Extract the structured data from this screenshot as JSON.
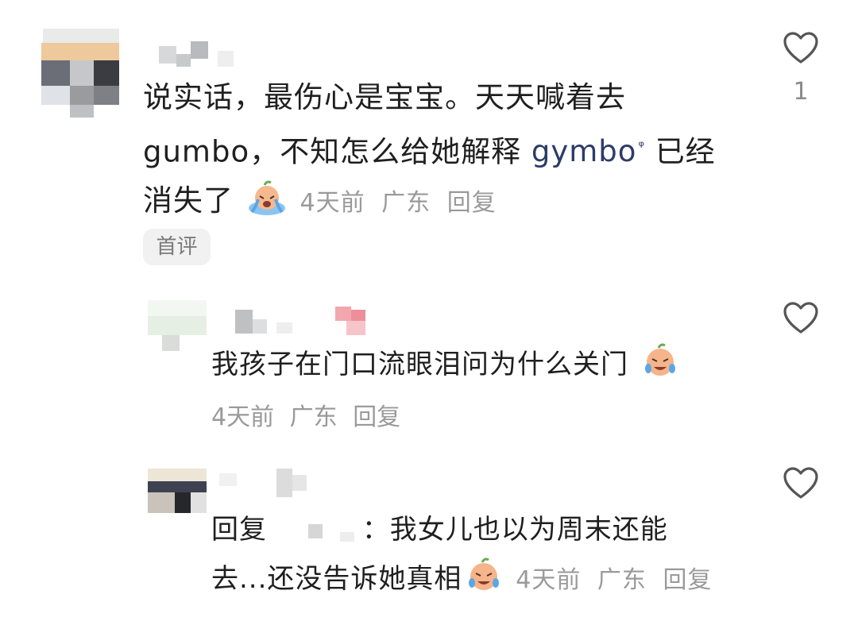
{
  "comments": [
    {
      "lines": [
        "说实话，最伤心是宝宝。天天喊着去",
        "gumbo，不知怎么给她解释",
        "消失了"
      ],
      "link_text": "gymbo",
      "link_suffix": "已经",
      "meta": {
        "time": "4天前",
        "location": "广东",
        "reply": "回复"
      },
      "tag": "首评",
      "likes": "1"
    },
    {
      "text": "我孩子在门口流眼泪问为什么关门",
      "meta": {
        "time": "4天前",
        "location": "广东",
        "reply": "回复"
      }
    },
    {
      "reply_prefix": "回复",
      "text_line1": "：我女儿也以为周末还能",
      "text_line2": "去...还没告诉她真相",
      "meta": {
        "time": "4天前",
        "location": "广东",
        "reply": "回复"
      }
    }
  ],
  "icons": {
    "like": "heart-outline-icon",
    "search_link": "search-icon",
    "emoji": "crying-emoji-icon"
  },
  "colors": {
    "link": "#2c3c68",
    "meta": "#9a9a9a",
    "tag_bg": "#f1f1f1"
  }
}
